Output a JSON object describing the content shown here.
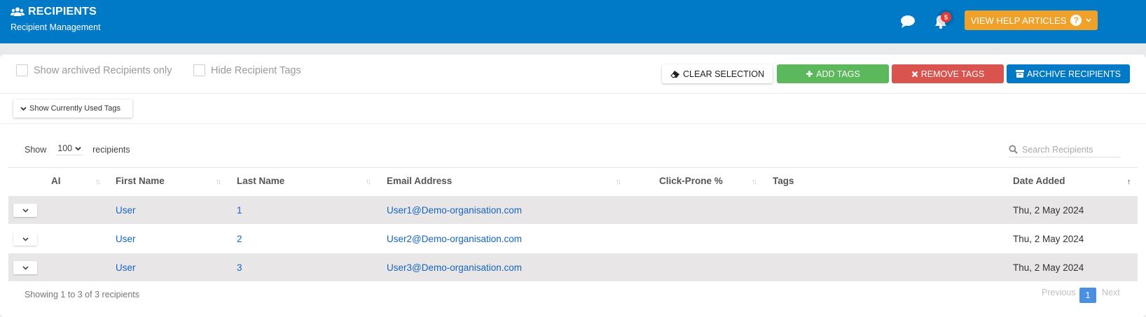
{
  "header": {
    "title": "RECIPIENTS",
    "subtitle": "Recipient Management",
    "notification_count": "5",
    "help_button_label": "VIEW HELP ARTICLES",
    "help_icon_glyph": "?"
  },
  "options": {
    "show_archived_label": "Show archived Recipients only",
    "hide_tags_label": "Hide Recipient Tags"
  },
  "actions": {
    "clear_selection": "CLEAR SELECTION",
    "add_tags": "ADD TAGS",
    "remove_tags": "REMOVE TAGS",
    "archive_recipients": "ARCHIVE RECIPIENTS"
  },
  "tags_toggle_label": "Show Currently Used Tags",
  "table_controls": {
    "show_label": "Show",
    "page_size": "100",
    "entries_label": "recipients",
    "search_placeholder": "Search Recipients"
  },
  "table": {
    "columns": [
      "AI",
      "First Name",
      "Last Name",
      "Email Address",
      "Click-Prone %",
      "Tags",
      "Date Added"
    ],
    "rows": [
      {
        "first_name": "User",
        "last_name": "1",
        "email": "User1@Demo-organisation.com",
        "click_prone": "",
        "tags": "",
        "date_added": "Thu, 2 May 2024"
      },
      {
        "first_name": "User",
        "last_name": "2",
        "email": "User2@Demo-organisation.com",
        "click_prone": "",
        "tags": "",
        "date_added": "Thu, 2 May 2024"
      },
      {
        "first_name": "User",
        "last_name": "3",
        "email": "User3@Demo-organisation.com",
        "click_prone": "",
        "tags": "",
        "date_added": "Thu, 2 May 2024"
      }
    ]
  },
  "footer": {
    "info": "Showing 1 to 3 of 3 recipients",
    "previous": "Previous",
    "current_page": "1",
    "next": "Next"
  },
  "colors": {
    "header_bg": "#0079c6",
    "help_button": "#f0a12a",
    "add_tags": "#5cb85c",
    "remove_tags": "#d9534f",
    "archive": "#0079c6",
    "link": "#1565c0"
  }
}
